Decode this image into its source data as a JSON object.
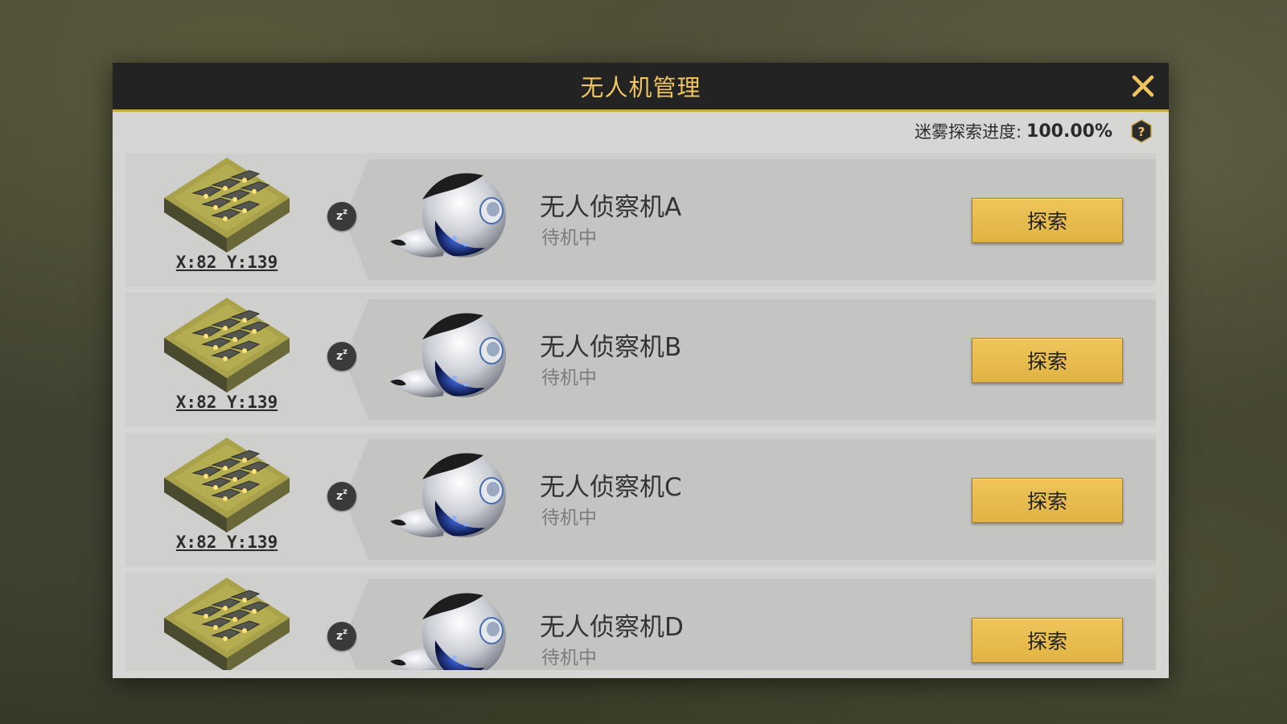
{
  "dialog": {
    "title": "无人机管理",
    "progress_label": "迷雾探索进度:",
    "progress_value": "100.00%",
    "progress_fraction": 1.0
  },
  "drones": [
    {
      "name": "无人侦察机A",
      "status": "待机中",
      "coords": "X:82 Y:139",
      "button": "探索"
    },
    {
      "name": "无人侦察机B",
      "status": "待机中",
      "coords": "X:82 Y:139",
      "button": "探索"
    },
    {
      "name": "无人侦察机C",
      "status": "待机中",
      "coords": "X:82 Y:139",
      "button": "探索"
    },
    {
      "name": "无人侦察机D",
      "status": "待机中",
      "coords": "",
      "button": "探索"
    }
  ],
  "icons": {
    "close": "close-icon",
    "help": "help-hexagon-icon",
    "sleep": "sleep-zz-icon",
    "base": "drone-base-tile-icon",
    "drone": "scout-drone-icon"
  },
  "colors": {
    "title_text": "#f0c560",
    "accent_line": "#c9a647",
    "button": "#e8bd4f",
    "titlebar": "#232323",
    "panel": "#d6d6d4"
  }
}
